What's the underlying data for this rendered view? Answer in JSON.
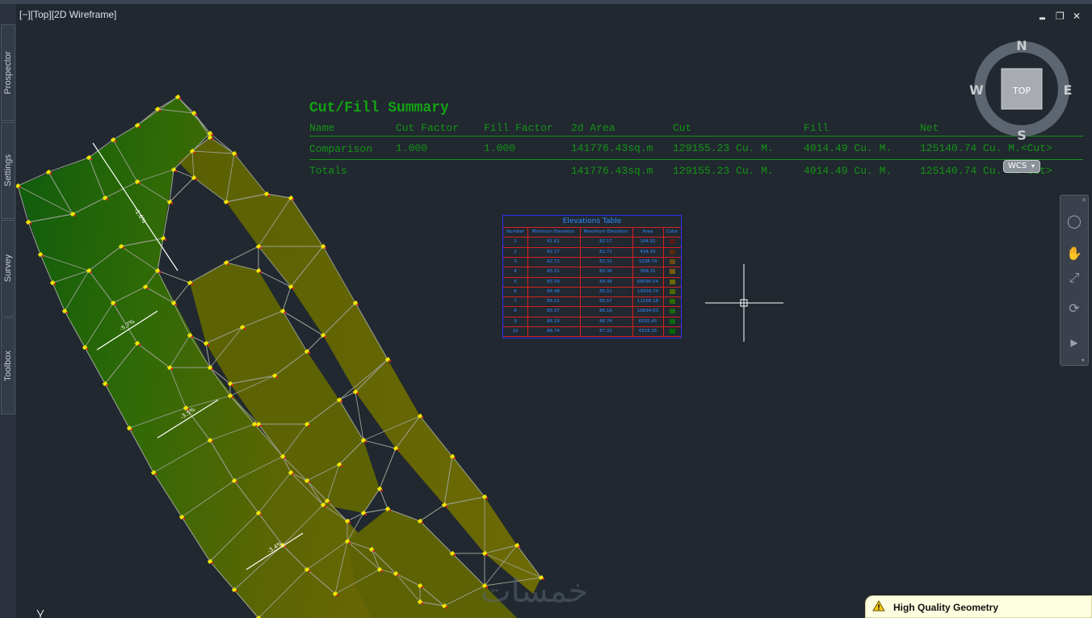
{
  "sidebar": {
    "tabs": [
      {
        "label": "Prospector"
      },
      {
        "label": "Settings"
      },
      {
        "label": "Survey"
      },
      {
        "label": "Toolbox"
      }
    ]
  },
  "viewport": {
    "label": "[−][Top][2D Wireframe]",
    "window_controls": {
      "minimize": "▂",
      "restore": "❐",
      "close": "✕"
    }
  },
  "viewcube": {
    "north": "N",
    "south": "S",
    "east": "E",
    "west": "W",
    "face": "TOP",
    "wcs": "WCS"
  },
  "cut_fill": {
    "title": "Cut/Fill Summary",
    "headers": [
      "Name",
      "Cut Factor",
      "Fill Factor",
      "2d Area",
      "Cut",
      "Fill",
      "Net"
    ],
    "rows": [
      [
        "Comparison",
        "1.000",
        "1.000",
        "141776.43sq.m",
        "129155.23 Cu. M.",
        "4014.49 Cu. M.",
        "125140.74 Cu. M.<Cut>"
      ],
      [
        "Totals",
        "",
        "",
        "141776.43sq.m",
        "129155.23 Cu. M.",
        "4014.49 Cu. M.",
        "125140.74 Cu. M.<Cut>"
      ]
    ]
  },
  "elevations_table": {
    "title": "Elevations Table",
    "headers": [
      "Number",
      "Minimum Elevation",
      "Maximum Elevation",
      "Area",
      "Color"
    ],
    "rows": [
      [
        "1",
        "81.61",
        "82.17",
        "104.91"
      ],
      [
        "2",
        "82.17",
        "82.71",
        "434.43"
      ],
      [
        "3",
        "82.71",
        "83.31",
        "1038.74"
      ],
      [
        "4",
        "83.31",
        "83.36",
        "308.31"
      ],
      [
        "5",
        "83.39",
        "84.48",
        "68090.54"
      ],
      [
        "6",
        "84.48",
        "85.01",
        "19939.70"
      ],
      [
        "7",
        "85.01",
        "85.57",
        "11166.18"
      ],
      [
        "8",
        "85.57",
        "86.16",
        "10694.03"
      ],
      [
        "9",
        "86.16",
        "86.74",
        "6592.45"
      ],
      [
        "10",
        "86.74",
        "87.32",
        "4318.05"
      ]
    ],
    "colors": [
      "#5a1a1a",
      "#5a2a10",
      "#6a4a10",
      "#7a5a10",
      "#6a6a00",
      "#4a6a00",
      "#2a6a00",
      "#1a6a10",
      "#0a6a10",
      "#006a00"
    ]
  },
  "parcel_labels": [
    "-1.6%",
    "-5.7%",
    "-3.5%",
    "-3.4%"
  ],
  "watermark": "خمسات",
  "notification": {
    "text": "High Quality Geometry"
  },
  "ucs": {
    "y_label": "Y"
  }
}
